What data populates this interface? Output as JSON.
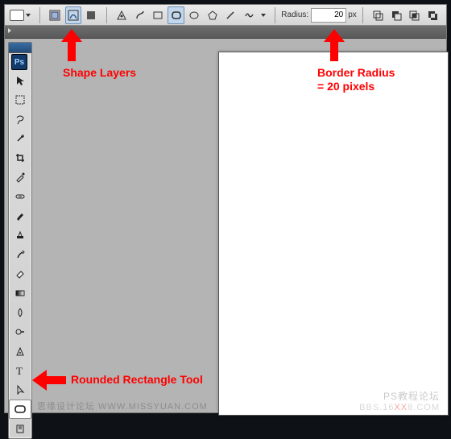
{
  "optionsBar": {
    "radiusLabel": "Radius:",
    "radiusValue": "20",
    "radiusUnit": "px"
  },
  "annotations": {
    "shapeLayers": "Shape Layers",
    "borderRadius1": "Border Radius",
    "borderRadius2": "= 20 pixels",
    "roundedRect": "Rounded Rectangle Tool"
  },
  "watermark": {
    "left": "思缘设计论坛  WWW.MISSYUAN.COM",
    "right1": "PS教程论坛",
    "right2_a": "BBS.16",
    "right2_xx": "XX",
    "right2_b": "8.COM"
  },
  "logo": "Ps"
}
